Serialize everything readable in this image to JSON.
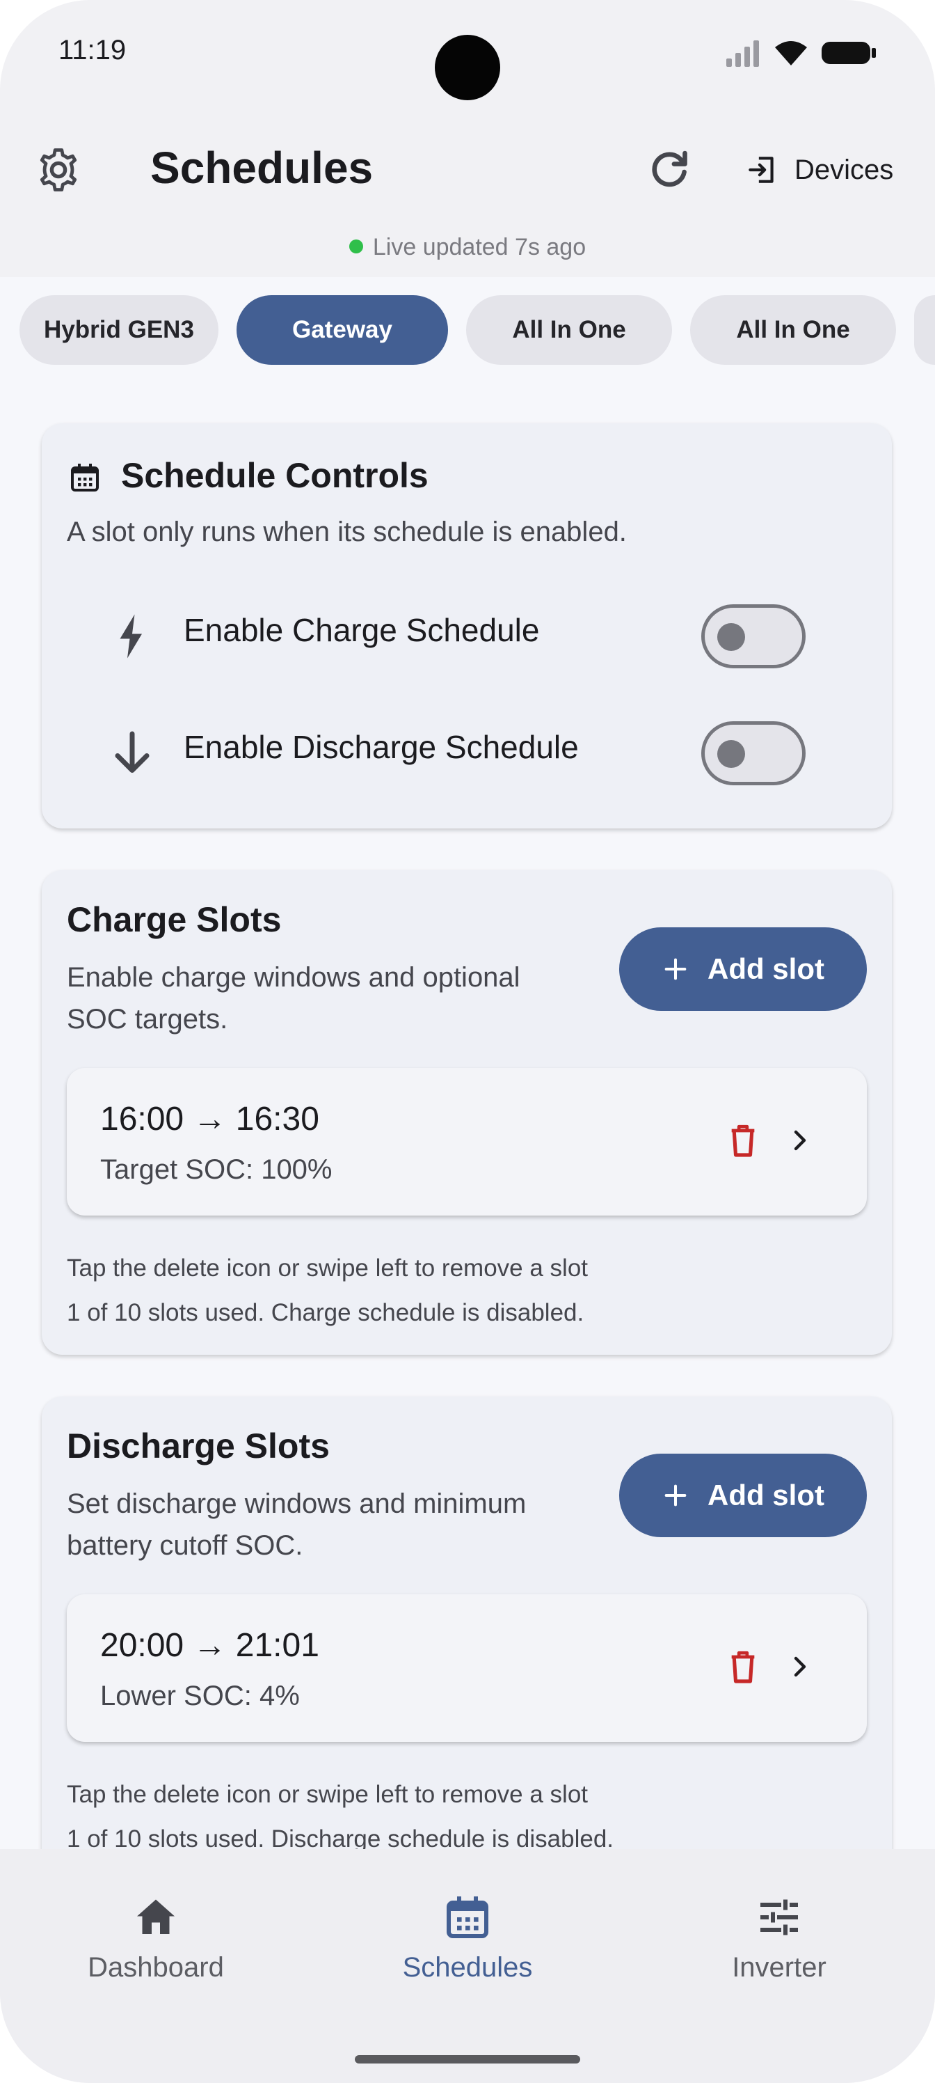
{
  "status_bar": {
    "time": "11:19"
  },
  "app_bar": {
    "title": "Schedules",
    "devices_label": "Devices",
    "icons": [
      "gear-icon",
      "refresh-icon",
      "login-icon"
    ]
  },
  "live_status": {
    "text": "Live updated 7s ago",
    "color": "#2fbf4a"
  },
  "device_tabs": [
    {
      "label": "Hybrid GEN3",
      "active": false
    },
    {
      "label": "Gateway",
      "active": true
    },
    {
      "label": "All In One",
      "active": false
    },
    {
      "label": "All In One",
      "active": false
    }
  ],
  "schedule_controls": {
    "title": "Schedule Controls",
    "subtitle": "A slot only runs when its schedule is enabled.",
    "charge_toggle": {
      "label": "Enable Charge Schedule",
      "enabled": false,
      "icon": "bolt-icon"
    },
    "discharge_toggle": {
      "label": "Enable Discharge Schedule",
      "enabled": false,
      "icon": "arrow-down-icon"
    }
  },
  "charge_slots": {
    "title": "Charge Slots",
    "subtitle_line1": "Enable charge windows and optional",
    "subtitle_line2": "SOC targets.",
    "add_label": "Add slot",
    "slot": {
      "time": "16:00 → 16:30",
      "soc": "Target SOC: 100%"
    },
    "hint": "Tap the delete icon or swipe left to remove a slot",
    "usage": "1 of 10 slots used. Charge schedule is disabled."
  },
  "discharge_slots": {
    "title": "Discharge Slots",
    "subtitle_line1": "Set discharge windows and minimum",
    "subtitle_line2": "battery cutoff SOC.",
    "add_label": "Add slot",
    "slot": {
      "time": "20:00 → 21:01",
      "soc": "Lower SOC: 4%"
    },
    "hint": "Tap the delete icon or swipe left to remove a slot",
    "usage": "1 of 10 slots used. Discharge schedule is disabled."
  },
  "bottom_nav": [
    {
      "label": "Dashboard",
      "icon": "home-icon",
      "active": false
    },
    {
      "label": "Schedules",
      "icon": "calendar-icon",
      "active": true
    },
    {
      "label": "Inverter",
      "icon": "sliders-icon",
      "active": false
    }
  ],
  "colors": {
    "accent": "#435f93",
    "delete": "#c62828",
    "background": "#f6f7fb"
  }
}
